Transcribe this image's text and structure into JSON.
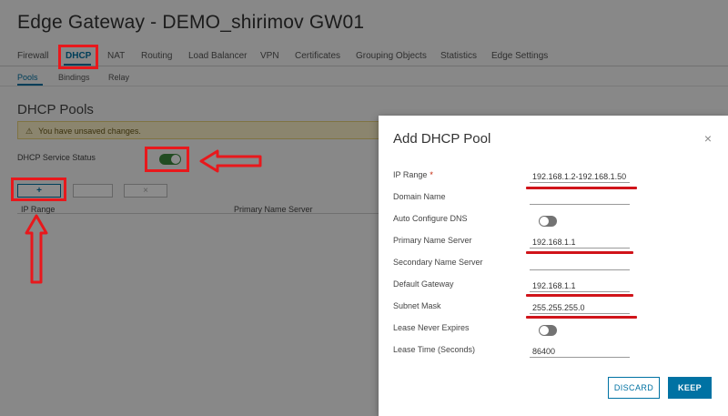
{
  "page": {
    "title": "Edge Gateway - DEMO_shirimov GW01",
    "main_tabs": [
      "Firewall",
      "DHCP",
      "NAT",
      "Routing",
      "Load Balancer",
      "VPN",
      "Certificates",
      "Grouping Objects",
      "Statistics",
      "Edge Settings"
    ],
    "sub_tabs": [
      "Pools",
      "Bindings",
      "Relay"
    ],
    "section_title": "DHCP Pools",
    "warning": "You have unsaved changes.",
    "service_status_label": "DHCP Service Status",
    "add_button": "+",
    "edit_button": "",
    "delete_button": "×",
    "grid_columns": [
      "IP Range",
      "Primary Name Server"
    ]
  },
  "modal": {
    "title": "Add DHCP Pool",
    "close": "×",
    "fields": [
      {
        "label": "IP Range",
        "required": "*",
        "value": "192.168.1.2-192.168.1.50"
      },
      {
        "label": "Domain Name",
        "value": ""
      },
      {
        "label": "Auto Configure DNS",
        "toggle": "off"
      },
      {
        "label": "Primary Name Server",
        "value": "192.168.1.1"
      },
      {
        "label": "Secondary Name Server",
        "value": ""
      },
      {
        "label": "Default Gateway",
        "value": "192.168.1.1"
      },
      {
        "label": "Subnet Mask",
        "value": "255.255.255.0"
      },
      {
        "label": "Lease Never Expires",
        "toggle": "off"
      },
      {
        "label": "Lease Time (Seconds)",
        "value": "86400"
      }
    ],
    "discard_label": "DISCARD",
    "keep_label": "KEEP"
  },
  "colors": {
    "accent": "#0072a3",
    "annotation_red": "#e8181c",
    "toggle_on": "#3e8b3f",
    "toggle_off": "#737373"
  }
}
